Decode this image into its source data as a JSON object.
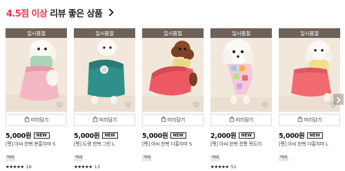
{
  "section": {
    "title_highlight": "4.5점 이상",
    "title_rest": "리뷰 좋은 상품"
  },
  "products": [
    {
      "badge": "일시품절",
      "preview_label": "미리담기",
      "price": "5,000원",
      "new_label": "NEW",
      "name": "[펫] 아씨 한복 분홍치마 S",
      "tag": "택배",
      "stars": "★★★★★",
      "review_count": "16"
    },
    {
      "badge": "일시품절",
      "preview_label": "미리담기",
      "price": "5,000원",
      "new_label": "NEW",
      "name": "[펫] 도령 한복 그린 L",
      "tag": "택배",
      "stars": "★★★★★",
      "review_count": "13"
    },
    {
      "badge": "일시품절",
      "preview_label": "미리담기",
      "price": "5,000원",
      "new_label": "NEW",
      "name": "[펫] 아씨 한복 다홍치마 S",
      "tag": "택배",
      "stars": "",
      "review_count": ""
    },
    {
      "badge": "일시품절",
      "preview_label": "미리담기",
      "price": "2,000원",
      "new_label": "NEW",
      "name": "[펫] 아씨 한복 전통 목도리",
      "tag": "택배",
      "stars": "★★★★★",
      "review_count": "51"
    },
    {
      "badge": "일시품절",
      "preview_label": "미리담기",
      "price": "5,000원",
      "new_label": "NEW",
      "name": "[펫] 아씨 한복 다홍치마 L",
      "tag": "택배",
      "stars": "",
      "review_count": ""
    }
  ],
  "colors": {
    "accent": "#e6354a",
    "badge_bg": "#6d6259"
  },
  "icons": {
    "chevron": "chevron-right-icon",
    "heart": "heart-icon",
    "bag": "shopping-bag-icon"
  }
}
